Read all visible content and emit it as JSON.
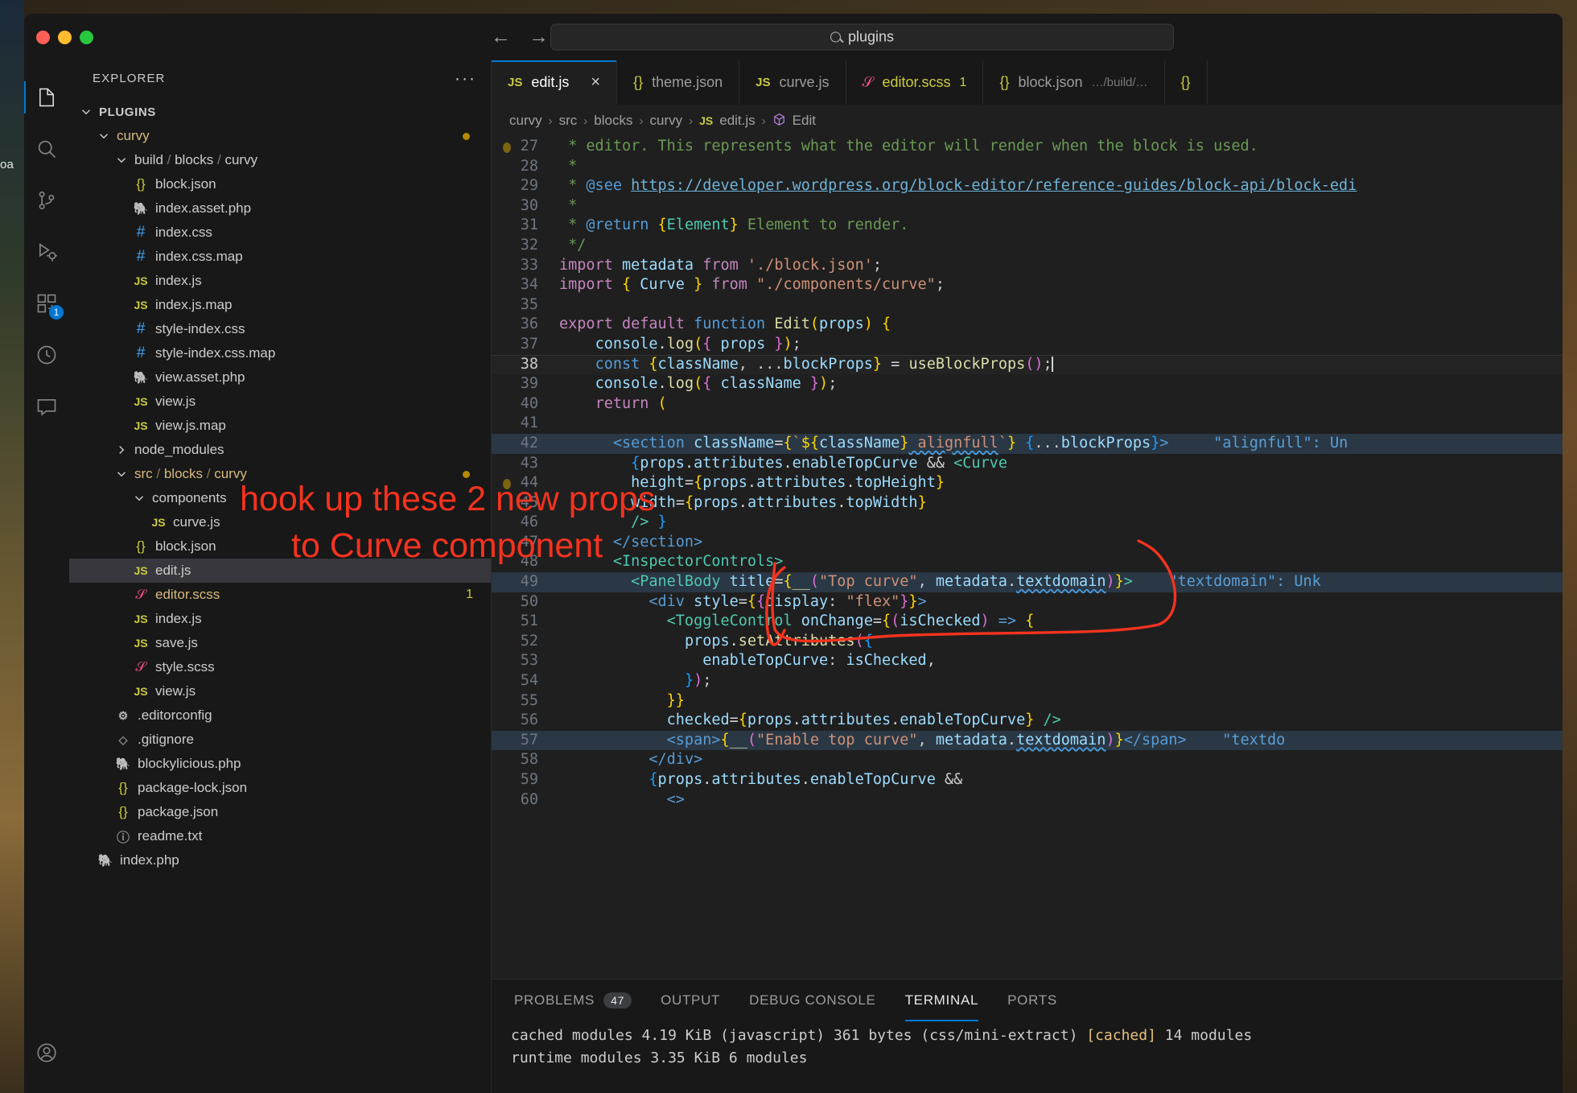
{
  "window": {
    "traffic_lights": [
      "close",
      "minimize",
      "maximize"
    ],
    "command_center_text": "plugins",
    "nav_back": "←",
    "nav_forward": "→"
  },
  "wallpaper": {
    "partial_label": "oa"
  },
  "activity_bar": {
    "items": [
      {
        "name": "explorer",
        "icon": "files-icon",
        "active": true,
        "badge": ""
      },
      {
        "name": "search",
        "icon": "search-icon",
        "active": false,
        "badge": ""
      },
      {
        "name": "source-control",
        "icon": "source-control-icon",
        "active": false,
        "badge": ""
      },
      {
        "name": "run-and-debug",
        "icon": "run-debug-icon",
        "active": false,
        "badge": ""
      },
      {
        "name": "extensions",
        "icon": "extensions-icon",
        "active": false,
        "badge": "1"
      },
      {
        "name": "testing",
        "icon": "beaker-icon",
        "active": false,
        "badge": ""
      },
      {
        "name": "comments",
        "icon": "comment-icon",
        "active": false,
        "badge": ""
      }
    ],
    "bottom_items": [
      {
        "name": "accounts",
        "icon": "account-icon"
      }
    ]
  },
  "sidebar": {
    "title": "EXPLORER",
    "more_actions": "···",
    "root": "PLUGINS",
    "tree": [
      {
        "label": "curvy",
        "type": "folder-open",
        "depth": 1,
        "style": "yellow",
        "modified_dot": true
      },
      {
        "label": "build / blocks / curvy",
        "type": "folder-open",
        "depth": 2,
        "style": "plain",
        "compact": true
      },
      {
        "label": "block.json",
        "type": "json",
        "depth": 3
      },
      {
        "label": "index.asset.php",
        "type": "php",
        "depth": 3
      },
      {
        "label": "index.css",
        "type": "css",
        "depth": 3
      },
      {
        "label": "index.css.map",
        "type": "css",
        "depth": 3
      },
      {
        "label": "index.js",
        "type": "js",
        "depth": 3
      },
      {
        "label": "index.js.map",
        "type": "js",
        "depth": 3
      },
      {
        "label": "style-index.css",
        "type": "css",
        "depth": 3
      },
      {
        "label": "style-index.css.map",
        "type": "css",
        "depth": 3
      },
      {
        "label": "view.asset.php",
        "type": "php",
        "depth": 3
      },
      {
        "label": "view.js",
        "type": "js",
        "depth": 3
      },
      {
        "label": "view.js.map",
        "type": "js",
        "depth": 3
      },
      {
        "label": "node_modules",
        "type": "folder-closed",
        "depth": 2,
        "style": "plain"
      },
      {
        "label": "src / blocks / curvy",
        "type": "folder-open",
        "depth": 2,
        "style": "yellow",
        "compact": true,
        "modified_dot": true
      },
      {
        "label": "components",
        "type": "folder-open",
        "depth": 3,
        "style": "plain"
      },
      {
        "label": "curve.js",
        "type": "js",
        "depth": 4
      },
      {
        "label": "block.json",
        "type": "json",
        "depth": 3
      },
      {
        "label": "edit.js",
        "type": "js",
        "depth": 3,
        "selected": true
      },
      {
        "label": "editor.scss",
        "type": "scss",
        "depth": 3,
        "style": "yellow",
        "error_count": "1"
      },
      {
        "label": "index.js",
        "type": "js",
        "depth": 3
      },
      {
        "label": "save.js",
        "type": "js",
        "depth": 3
      },
      {
        "label": "style.scss",
        "type": "scss",
        "depth": 3
      },
      {
        "label": "view.js",
        "type": "js",
        "depth": 3
      },
      {
        "label": ".editorconfig",
        "type": "gear",
        "depth": 2
      },
      {
        "label": ".gitignore",
        "type": "git",
        "depth": 2
      },
      {
        "label": "blockylicious.php",
        "type": "php",
        "depth": 2
      },
      {
        "label": "package-lock.json",
        "type": "json",
        "depth": 2
      },
      {
        "label": "package.json",
        "type": "json",
        "depth": 2
      },
      {
        "label": "readme.txt",
        "type": "info",
        "depth": 2
      },
      {
        "label": "index.php",
        "type": "php",
        "depth": 1
      }
    ]
  },
  "tabs": [
    {
      "label": "edit.js",
      "icon": "js",
      "active": true,
      "closable": true,
      "close_glyph": "×"
    },
    {
      "label": "theme.json",
      "icon": "json",
      "active": false
    },
    {
      "label": "curve.js",
      "icon": "js",
      "active": false
    },
    {
      "label": "editor.scss",
      "icon": "scss",
      "active": false,
      "count": "1",
      "name_color": "yellow"
    },
    {
      "label": "block.json",
      "icon": "json",
      "active": false,
      "sublabel": "…/build/…"
    },
    {
      "label": "",
      "icon": "json",
      "active": false
    }
  ],
  "breadcrumb": {
    "items": [
      "curvy",
      "src",
      "blocks",
      "curvy",
      "edit.js",
      "Edit"
    ],
    "separator": "›",
    "file_icon": "JS",
    "symbol_icon": "cube-icon"
  },
  "code": {
    "first_line": 27,
    "active_line": 38,
    "lines": [
      {
        "n": 27,
        "html": "<span class='c-com'> * editor. This represents what the editor will render when the block is used.</span>"
      },
      {
        "n": 28,
        "html": "<span class='c-com'> *</span>"
      },
      {
        "n": 29,
        "html": "<span class='c-com'> * </span><span class='c-doc'>@see</span><span class='c-com'> </span><span class='c-link'>https://developer.wordpress.org/block-editor/reference-guides/block-api/block-edi</span>"
      },
      {
        "n": 30,
        "html": "<span class='c-com'> *</span>"
      },
      {
        "n": 31,
        "html": "<span class='c-com'> * </span><span class='c-doc'>@return</span><span class='c-com'> </span><span class='c-br-y'>{</span><span class='c-type'>Element</span><span class='c-br-y'>}</span><span class='c-com'> Element to render.</span>"
      },
      {
        "n": 32,
        "html": "<span class='c-com'> */</span>"
      },
      {
        "n": 33,
        "html": "<span class='c-kw'>import</span><span class='c-var'> metadata </span><span class='c-kw'>from</span><span class='c-str'> './block.json'</span><span class='c-punc'>;</span>"
      },
      {
        "n": 34,
        "html": "<span class='c-kw'>import</span><span class='c-plain'> </span><span class='c-br-y'>{</span><span class='c-var'> Curve </span><span class='c-br-y'>}</span><span class='c-plain'> </span><span class='c-kw'>from</span><span class='c-str'> \"./components/curve\"</span><span class='c-punc'>;</span>"
      },
      {
        "n": 35,
        "html": ""
      },
      {
        "n": 36,
        "html": "<span class='c-kw'>export default</span><span class='c-kw2'> function</span><span class='c-fn'> Edit</span><span class='c-br-y'>(</span><span class='c-var'>props</span><span class='c-br-y'>)</span><span class='c-plain'> </span><span class='c-br-y'>{</span>"
      },
      {
        "n": 37,
        "html": "    <span class='c-var'>console</span><span class='c-plain'>.</span><span class='c-fn'>log</span><span class='c-br-y'>(</span><span class='c-br-p'>{</span><span class='c-var'> props </span><span class='c-br-p'>}</span><span class='c-br-y'>)</span><span class='c-punc'>;</span>"
      },
      {
        "n": 38,
        "html": "    <span class='c-kw2'>const</span><span class='c-plain'> </span><span class='c-br-y'>{</span><span class='c-var'>className</span><span class='c-punc'>, ...</span><span class='c-var'>blockProps</span><span class='c-br-y'>}</span><span class='c-plain'> = </span><span class='c-fn'>useBlockProps</span><span class='c-br-p'>()</span><span class='c-punc'>;</span><span class='caret'></span>",
        "current": true
      },
      {
        "n": 39,
        "html": "    <span class='c-var'>console</span><span class='c-plain'>.</span><span class='c-fn'>log</span><span class='c-br-y'>(</span><span class='c-br-p'>{</span><span class='c-var'> className </span><span class='c-br-p'>}</span><span class='c-br-y'>)</span><span class='c-punc'>;</span>"
      },
      {
        "n": 40,
        "html": "    <span class='c-kw'>return</span><span class='c-plain'> </span><span class='c-br-y'>(</span>"
      },
      {
        "n": 41,
        "html": ""
      },
      {
        "n": 42,
        "html": "      <span class='c-tag'>&lt;section</span><span class='c-var'> className</span><span class='c-plain'>=</span><span class='c-br-y'>{</span><span class='c-str'>`</span><span class='c-br-y'>$</span><span class='c-br-y'>{</span><span class='c-var'>className</span><span class='c-br-y'>}</span><span class='c-str squiggle'> alignfull</span><span class='c-str'>`</span><span class='c-br-y'>}</span><span class='c-plain'> </span><span class='c-br-b'>{</span><span class='c-punc'>...</span><span class='c-var'>blockProps</span><span class='c-br-b'>}</span><span class='c-tag'>&gt;</span><span class='c-plain'>   </span><span class='c-hint'>  \"alignfull\": Un</span>",
        "highlight": true
      },
      {
        "n": 43,
        "html": "        <span class='c-br-b'>{</span><span class='c-var'>props</span><span class='c-plain'>.</span><span class='c-var'>attributes</span><span class='c-plain'>.</span><span class='c-var'>enableTopCurve</span><span class='c-plain'> </span><span class='c-punc'>&amp;&amp;</span><span class='c-plain'> </span><span class='c-type'>&lt;Curve</span>"
      },
      {
        "n": 44,
        "html": "        <span class='c-var'>height</span><span class='c-plain'>=</span><span class='c-br-y'>{</span><span class='c-var'>props</span><span class='c-plain'>.</span><span class='c-var'>attributes</span><span class='c-plain'>.</span><span class='c-var'>topHeight</span><span class='c-br-y'>}</span>"
      },
      {
        "n": 45,
        "html": "        <span class='c-var'>width</span><span class='c-plain'>=</span><span class='c-br-y'>{</span><span class='c-var'>props</span><span class='c-plain'>.</span><span class='c-var'>attributes</span><span class='c-plain'>.</span><span class='c-var'>topWidth</span><span class='c-br-y'>}</span>"
      },
      {
        "n": 46,
        "html": "        <span class='c-type'>/&gt;</span><span class='c-plain'> </span><span class='c-br-b'>}</span>"
      },
      {
        "n": 47,
        "html": "      <span class='c-tag'>&lt;/section&gt;</span>"
      },
      {
        "n": 48,
        "html": "      <span class='c-type'>&lt;InspectorControls&gt;</span>"
      },
      {
        "n": 49,
        "html": "        <span class='c-type'>&lt;PanelBody</span><span class='c-var'> title</span><span class='c-plain'>=</span><span class='c-br-y'>{</span><span class='c-fn'>__</span><span class='c-br-p'>(</span><span class='c-str'>\"Top curve\"</span><span class='c-punc'>, </span><span class='c-var'>metadata</span><span class='c-plain'>.</span><span class='c-var squiggle'>textdomain</span><span class='c-br-p'>)</span><span class='c-br-y'>}</span><span class='c-type'>&gt;</span><span class='c-plain'>   </span><span class='c-hint'> \"textdomain\": Unk</span>",
        "highlight": true
      },
      {
        "n": 50,
        "html": "          <span class='c-tag'>&lt;div</span><span class='c-var'> style</span><span class='c-plain'>=</span><span class='c-br-y'>{</span><span class='c-br-p'>{</span><span class='c-var'>display</span><span class='c-punc'>: </span><span class='c-str'>\"flex\"</span><span class='c-br-p'>}</span><span class='c-br-y'>}</span><span class='c-tag'>&gt;</span>"
      },
      {
        "n": 51,
        "html": "            <span class='c-type'>&lt;ToggleControl</span><span class='c-var'> onChange</span><span class='c-plain'>=</span><span class='c-br-y'>{</span><span class='c-br-p'>(</span><span class='c-var'>isChecked</span><span class='c-br-p'>)</span><span class='c-plain'> </span><span class='c-kw2'>=&gt;</span><span class='c-plain'> </span><span class='c-br-y'>{</span>"
      },
      {
        "n": 52,
        "html": "              <span class='c-var'>props</span><span class='c-plain'>.</span><span class='c-fn'>setAttributes</span><span class='c-br-p'>(</span><span class='c-br-b'>{</span>"
      },
      {
        "n": 53,
        "html": "                <span class='c-var'>enableTopCurve</span><span class='c-punc'>: </span><span class='c-var'>isChecked</span><span class='c-punc'>,</span>"
      },
      {
        "n": 54,
        "html": "              <span class='c-br-b'>}</span><span class='c-br-p'>)</span><span class='c-punc'>;</span>"
      },
      {
        "n": 55,
        "html": "            <span class='c-br-y'>}</span><span class='c-br-y'>}</span>"
      },
      {
        "n": 56,
        "html": "            <span class='c-var'>checked</span><span class='c-plain'>=</span><span class='c-br-y'>{</span><span class='c-var'>props</span><span class='c-plain'>.</span><span class='c-var'>attributes</span><span class='c-plain'>.</span><span class='c-var'>enableTopCurve</span><span class='c-br-y'>}</span><span class='c-type'> /&gt;</span>"
      },
      {
        "n": 57,
        "html": "            <span class='c-tag'>&lt;span&gt;</span><span class='c-br-y'>{</span><span class='c-fn'>__</span><span class='c-br-p'>(</span><span class='c-str'>\"Enable top curve\"</span><span class='c-punc'>, </span><span class='c-var'>metadata</span><span class='c-plain'>.</span><span class='c-var squiggle'>textdomain</span><span class='c-br-p'>)</span><span class='c-br-y'>}</span><span class='c-tag'>&lt;/span&gt;</span><span class='c-plain'>   </span><span class='c-hint'> \"textdo</span>",
        "highlight": true
      },
      {
        "n": 58,
        "html": "          <span class='c-tag'>&lt;/div&gt;</span>"
      },
      {
        "n": 59,
        "html": "          <span class='c-br-b'>{</span><span class='c-var'>props</span><span class='c-plain'>.</span><span class='c-var'>attributes</span><span class='c-plain'>.</span><span class='c-var'>enableTopCurve</span><span class='c-plain'> </span><span class='c-punc'>&amp;&amp;</span>"
      },
      {
        "n": 60,
        "html": "            <span class='c-tag'>&lt;&gt;</span>"
      }
    ]
  },
  "panel": {
    "tabs": [
      {
        "label": "PROBLEMS",
        "badge": "47",
        "active": false
      },
      {
        "label": "OUTPUT",
        "badge": "",
        "active": false
      },
      {
        "label": "DEBUG CONSOLE",
        "badge": "",
        "active": false
      },
      {
        "label": "TERMINAL",
        "badge": "",
        "active": true
      },
      {
        "label": "PORTS",
        "badge": "",
        "active": false
      }
    ],
    "terminal_lines": [
      "cached modules 4.19 KiB (javascript) 361 bytes (css/mini-extract) [cached] 14 modules",
      "runtime modules 3.35 KiB 6 modules"
    ],
    "terminal_cached_token": "[cached]"
  },
  "annotation": {
    "line1": "hook up these 2 new props",
    "line2": "to Curve component",
    "color": "#f4331f",
    "circle": "hand-drawn-oval-around-lines-44-46"
  },
  "colors": {
    "accent": "#0078d4",
    "editor_bg": "#1f1f1f",
    "sidebar_bg": "#181818",
    "annotation_red": "#f4331f",
    "selection_highlight": "#2a3744"
  }
}
